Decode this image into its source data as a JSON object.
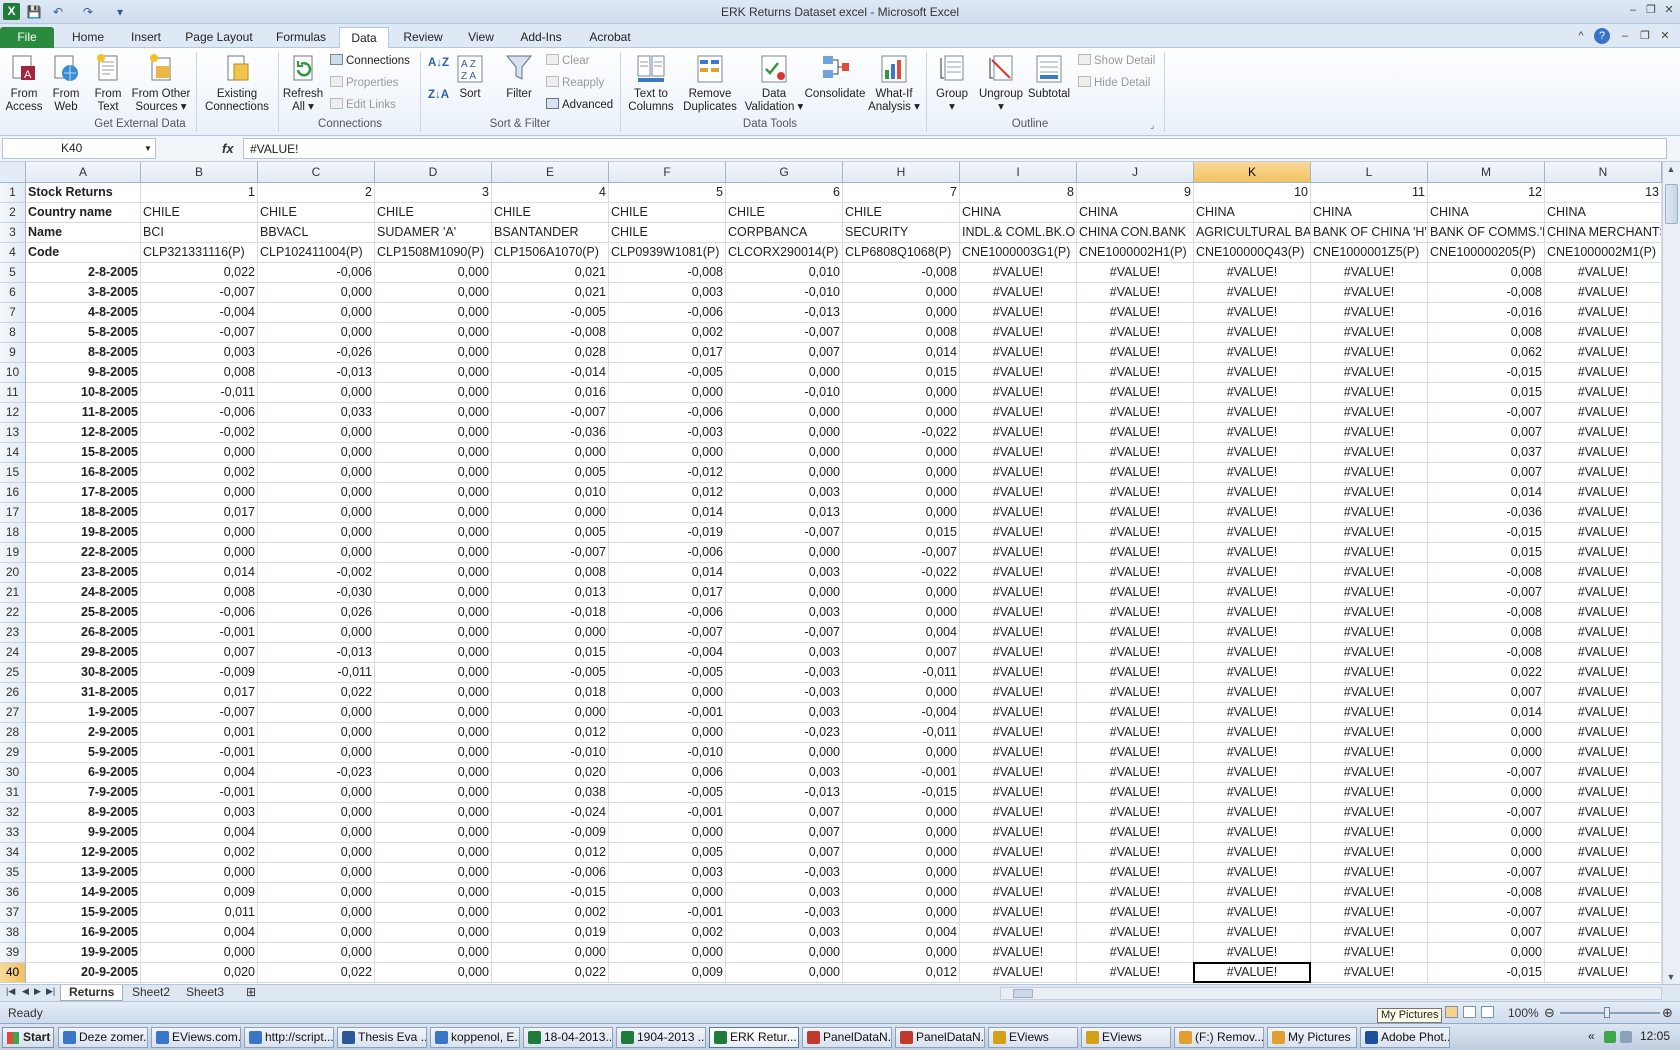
{
  "window": {
    "title": "ERK Returns Dataset excel  -  Microsoft Excel",
    "app_icon": "X",
    "controls": {
      "minimize": "–",
      "restore": "❐",
      "close": "✕"
    },
    "ribbon_controls": {
      "collapse": "^",
      "help": "?",
      "minimize": "–",
      "restore": "❐",
      "close": "✕"
    }
  },
  "qat": {
    "save": "💾",
    "undo": "↶",
    "redo": "↷",
    "customize": "▾"
  },
  "tabs": [
    "File",
    "Home",
    "Insert",
    "Page Layout",
    "Formulas",
    "Data",
    "Review",
    "View",
    "Add-Ins",
    "Acrobat"
  ],
  "active_tab": "Data",
  "ribbon": {
    "get_external": {
      "label": "Get External Data",
      "buttons": [
        "From\nAccess",
        "From\nWeb",
        "From\nText",
        "From Other\nSources ▾",
        "Existing\nConnections"
      ]
    },
    "connections": {
      "label": "Connections",
      "refresh": "Refresh\nAll ▾",
      "items": [
        "Connections",
        "Properties",
        "Edit Links"
      ]
    },
    "sort_filter": {
      "label": "Sort & Filter",
      "sort": "Sort",
      "filter": "Filter",
      "items": [
        "Clear",
        "Reapply",
        "Advanced"
      ]
    },
    "data_tools": {
      "label": "Data Tools",
      "buttons": [
        "Text to\nColumns",
        "Remove\nDuplicates",
        "Data\nValidation ▾",
        "Consolidate",
        "What-If\nAnalysis ▾"
      ]
    },
    "outline": {
      "label": "Outline",
      "buttons": [
        "Group\n▾",
        "Ungroup\n▾",
        "Subtotal"
      ],
      "items": [
        "Show Detail",
        "Hide Detail"
      ]
    }
  },
  "formula_bar": {
    "name_box": "K40",
    "fx": "fx",
    "formula": "#VALUE!"
  },
  "sheet": {
    "columns": [
      "A",
      "B",
      "C",
      "D",
      "E",
      "F",
      "G",
      "H",
      "I",
      "J",
      "K",
      "L",
      "M",
      "N"
    ],
    "selected_column": "K",
    "selected_row": 40,
    "header_rows": [
      {
        "num": "1",
        "cells": [
          "Stock Returns",
          "1",
          "2",
          "3",
          "4",
          "5",
          "6",
          "7",
          "8",
          "9",
          "10",
          "11",
          "12",
          "13"
        ]
      },
      {
        "num": "2",
        "cells": [
          "Country name",
          "CHILE",
          "CHILE",
          "CHILE",
          "CHILE",
          "CHILE",
          "CHILE",
          "CHILE",
          "CHINA",
          "CHINA",
          "CHINA",
          "CHINA",
          "CHINA",
          "CHINA"
        ]
      },
      {
        "num": "3",
        "cells": [
          "Name",
          "BCI",
          "BBVACL",
          "SUDAMER 'A'",
          "BSANTANDER",
          "CHILE",
          "CORPBANCA",
          "SECURITY",
          "INDL.& COML.BK.OF",
          "CHINA CON.BANK",
          "AGRICULTURAL BANK",
          "BANK OF CHINA 'H'",
          "BANK OF COMMS.'H'",
          "CHINA MERCHANTS"
        ]
      },
      {
        "num": "4",
        "cells": [
          "Code",
          "CLP321331116(P)",
          "CLP102411004(P)",
          "CLP1508M1090(P)",
          "CLP1506A1070(P)",
          "CLP0939W1081(P)",
          "CLCORX290014(P)",
          "CLP6808Q1068(P)",
          "CNE1000003G1(P)",
          "CNE1000002H1(P)",
          "CNE100000Q43(P)",
          "CNE1000001Z5(P)",
          "CNE100000205(P)",
          "CNE1000002M1(P)"
        ]
      }
    ],
    "error_value": "#VALUE!",
    "data_rows": [
      {
        "num": "5",
        "date": "2-8-2005",
        "v": [
          "0,022",
          "-0,006",
          "0,000",
          "0,021",
          "-0,008",
          "0,010",
          "-0,008"
        ],
        "m": "0,008"
      },
      {
        "num": "6",
        "date": "3-8-2005",
        "v": [
          "-0,007",
          "0,000",
          "0,000",
          "0,021",
          "0,003",
          "-0,010",
          "0,000"
        ],
        "m": "-0,008"
      },
      {
        "num": "7",
        "date": "4-8-2005",
        "v": [
          "-0,004",
          "0,000",
          "0,000",
          "-0,005",
          "-0,006",
          "-0,013",
          "0,000"
        ],
        "m": "-0,016"
      },
      {
        "num": "8",
        "date": "5-8-2005",
        "v": [
          "-0,007",
          "0,000",
          "0,000",
          "-0,008",
          "0,002",
          "-0,007",
          "0,008"
        ],
        "m": "0,008"
      },
      {
        "num": "9",
        "date": "8-8-2005",
        "v": [
          "0,003",
          "-0,026",
          "0,000",
          "0,028",
          "0,017",
          "0,007",
          "0,014"
        ],
        "m": "0,062"
      },
      {
        "num": "10",
        "date": "9-8-2005",
        "v": [
          "0,008",
          "-0,013",
          "0,000",
          "-0,014",
          "-0,005",
          "0,000",
          "0,015"
        ],
        "m": "-0,015"
      },
      {
        "num": "11",
        "date": "10-8-2005",
        "v": [
          "-0,011",
          "0,000",
          "0,000",
          "0,016",
          "0,000",
          "-0,010",
          "0,000"
        ],
        "m": "0,015"
      },
      {
        "num": "12",
        "date": "11-8-2005",
        "v": [
          "-0,006",
          "0,033",
          "0,000",
          "-0,007",
          "-0,006",
          "0,000",
          "0,000"
        ],
        "m": "-0,007"
      },
      {
        "num": "13",
        "date": "12-8-2005",
        "v": [
          "-0,002",
          "0,000",
          "0,000",
          "-0,036",
          "-0,003",
          "0,000",
          "-0,022"
        ],
        "m": "0,007"
      },
      {
        "num": "14",
        "date": "15-8-2005",
        "v": [
          "0,000",
          "0,000",
          "0,000",
          "0,000",
          "0,000",
          "0,000",
          "0,000"
        ],
        "m": "0,037"
      },
      {
        "num": "15",
        "date": "16-8-2005",
        "v": [
          "0,002",
          "0,000",
          "0,000",
          "0,005",
          "-0,012",
          "0,000",
          "0,000"
        ],
        "m": "0,007"
      },
      {
        "num": "16",
        "date": "17-8-2005",
        "v": [
          "0,000",
          "0,000",
          "0,000",
          "0,010",
          "0,012",
          "0,003",
          "0,000"
        ],
        "m": "0,014"
      },
      {
        "num": "17",
        "date": "18-8-2005",
        "v": [
          "0,017",
          "0,000",
          "0,000",
          "0,000",
          "0,014",
          "0,013",
          "0,000"
        ],
        "m": "-0,036"
      },
      {
        "num": "18",
        "date": "19-8-2005",
        "v": [
          "0,000",
          "0,000",
          "0,000",
          "0,005",
          "-0,019",
          "-0,007",
          "0,015"
        ],
        "m": "-0,015"
      },
      {
        "num": "19",
        "date": "22-8-2005",
        "v": [
          "0,000",
          "0,000",
          "0,000",
          "-0,007",
          "-0,006",
          "0,000",
          "-0,007"
        ],
        "m": "0,015"
      },
      {
        "num": "20",
        "date": "23-8-2005",
        "v": [
          "0,014",
          "-0,002",
          "0,000",
          "0,008",
          "0,014",
          "0,003",
          "-0,022"
        ],
        "m": "-0,008"
      },
      {
        "num": "21",
        "date": "24-8-2005",
        "v": [
          "0,008",
          "-0,030",
          "0,000",
          "0,013",
          "0,017",
          "0,000",
          "0,000"
        ],
        "m": "-0,007"
      },
      {
        "num": "22",
        "date": "25-8-2005",
        "v": [
          "-0,006",
          "0,026",
          "0,000",
          "-0,018",
          "-0,006",
          "0,003",
          "0,000"
        ],
        "m": "-0,008"
      },
      {
        "num": "23",
        "date": "26-8-2005",
        "v": [
          "-0,001",
          "0,000",
          "0,000",
          "0,000",
          "-0,007",
          "-0,007",
          "0,004"
        ],
        "m": "0,008"
      },
      {
        "num": "24",
        "date": "29-8-2005",
        "v": [
          "0,007",
          "-0,013",
          "0,000",
          "0,015",
          "-0,004",
          "0,003",
          "0,007"
        ],
        "m": "-0,008"
      },
      {
        "num": "25",
        "date": "30-8-2005",
        "v": [
          "-0,009",
          "-0,011",
          "0,000",
          "-0,005",
          "-0,005",
          "-0,003",
          "-0,011"
        ],
        "m": "0,022"
      },
      {
        "num": "26",
        "date": "31-8-2005",
        "v": [
          "0,017",
          "0,022",
          "0,000",
          "0,018",
          "0,000",
          "-0,003",
          "0,000"
        ],
        "m": "0,007"
      },
      {
        "num": "27",
        "date": "1-9-2005",
        "v": [
          "-0,007",
          "0,000",
          "0,000",
          "0,000",
          "-0,001",
          "0,003",
          "-0,004"
        ],
        "m": "0,014"
      },
      {
        "num": "28",
        "date": "2-9-2005",
        "v": [
          "0,001",
          "0,000",
          "0,000",
          "0,012",
          "0,000",
          "-0,023",
          "-0,011"
        ],
        "m": "0,000"
      },
      {
        "num": "29",
        "date": "5-9-2005",
        "v": [
          "-0,001",
          "0,000",
          "0,000",
          "-0,010",
          "-0,010",
          "0,000",
          "0,000"
        ],
        "m": "0,000"
      },
      {
        "num": "30",
        "date": "6-9-2005",
        "v": [
          "0,004",
          "-0,023",
          "0,000",
          "0,020",
          "0,006",
          "0,003",
          "-0,001"
        ],
        "m": "-0,007"
      },
      {
        "num": "31",
        "date": "7-9-2005",
        "v": [
          "-0,001",
          "0,000",
          "0,000",
          "0,038",
          "-0,005",
          "-0,013",
          "-0,015"
        ],
        "m": "0,000"
      },
      {
        "num": "32",
        "date": "8-9-2005",
        "v": [
          "0,003",
          "0,000",
          "0,000",
          "-0,024",
          "-0,001",
          "0,007",
          "0,000"
        ],
        "m": "-0,007"
      },
      {
        "num": "33",
        "date": "9-9-2005",
        "v": [
          "0,004",
          "0,000",
          "0,000",
          "-0,009",
          "0,000",
          "0,007",
          "0,000"
        ],
        "m": "0,000"
      },
      {
        "num": "34",
        "date": "12-9-2005",
        "v": [
          "0,002",
          "0,000",
          "0,000",
          "0,012",
          "0,005",
          "0,007",
          "0,000"
        ],
        "m": "0,000"
      },
      {
        "num": "35",
        "date": "13-9-2005",
        "v": [
          "0,000",
          "0,000",
          "0,000",
          "-0,006",
          "0,003",
          "-0,003",
          "0,000"
        ],
        "m": "-0,007"
      },
      {
        "num": "36",
        "date": "14-9-2005",
        "v": [
          "0,009",
          "0,000",
          "0,000",
          "-0,015",
          "0,000",
          "0,003",
          "0,000"
        ],
        "m": "-0,008"
      },
      {
        "num": "37",
        "date": "15-9-2005",
        "v": [
          "0,011",
          "0,000",
          "0,000",
          "0,002",
          "-0,001",
          "-0,003",
          "0,000"
        ],
        "m": "-0,007"
      },
      {
        "num": "38",
        "date": "16-9-2005",
        "v": [
          "0,004",
          "0,000",
          "0,000",
          "0,019",
          "0,002",
          "0,003",
          "0,004"
        ],
        "m": "0,007"
      },
      {
        "num": "39",
        "date": "19-9-2005",
        "v": [
          "0,000",
          "0,000",
          "0,000",
          "0,000",
          "0,000",
          "0,000",
          "0,000"
        ],
        "m": "0,000"
      },
      {
        "num": "40",
        "date": "20-9-2005",
        "v": [
          "0,020",
          "0,022",
          "0,000",
          "0,022",
          "0,009",
          "0,000",
          "0,012"
        ],
        "m": "-0,015"
      }
    ]
  },
  "sheet_tabs": [
    "Returns",
    "Sheet2",
    "Sheet3"
  ],
  "active_sheet": "Returns",
  "status": {
    "ready": "Ready",
    "zoom": "100%",
    "tooltip": "My Pictures",
    "minus": "⊖",
    "plus": "⊕"
  },
  "taskbar": {
    "start": "Start",
    "tasks": [
      "Deze zomer...",
      "EViews.com...",
      "http://script...",
      "Thesis Eva ...",
      "koppenol, E...",
      "18-04-2013...",
      "1904-2013 ...",
      "ERK Retur...",
      "PanelDataN...",
      "PanelDataN...",
      "EViews",
      "EViews",
      "(F:) Remov...",
      "My Pictures",
      "Adobe Phot..."
    ],
    "active_task": "ERK Retur...",
    "clock": "12:05",
    "tray_arrow": "«"
  },
  "colors": {
    "file_tab": "#2a8a3e",
    "selection_header": "#f1c15f",
    "grid_line": "#d6dde6",
    "header_bg": "#e2e9f2"
  }
}
